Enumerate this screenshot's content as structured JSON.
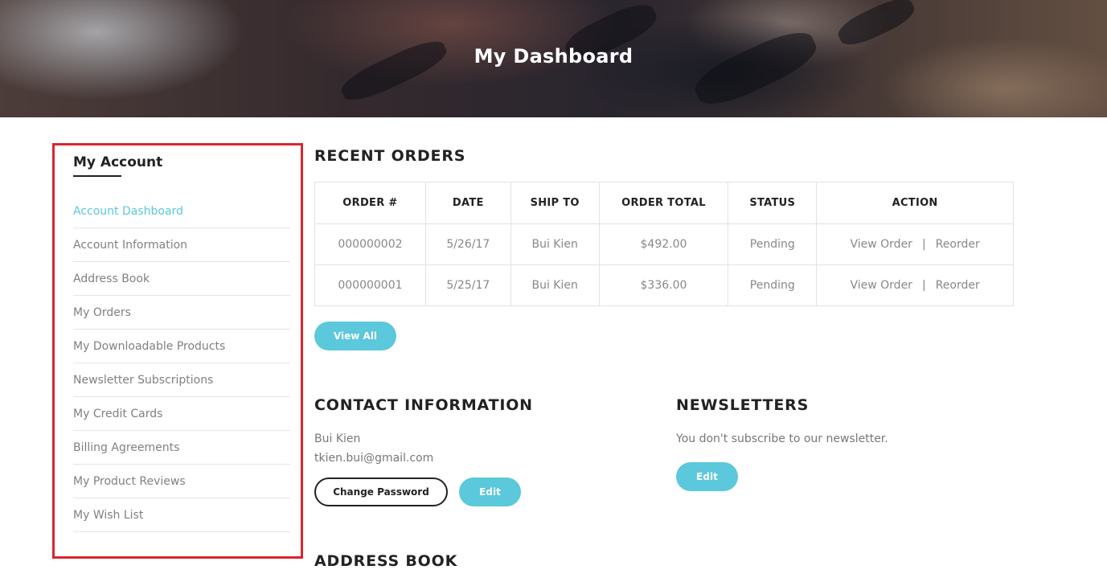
{
  "hero": {
    "title": "My Dashboard"
  },
  "sidebar": {
    "title": "My Account",
    "items": [
      {
        "label": "Account Dashboard"
      },
      {
        "label": "Account Information"
      },
      {
        "label": "Address Book"
      },
      {
        "label": "My Orders"
      },
      {
        "label": "My Downloadable Products"
      },
      {
        "label": "Newsletter Subscriptions"
      },
      {
        "label": "My Credit Cards"
      },
      {
        "label": "Billing Agreements"
      },
      {
        "label": "My Product Reviews"
      },
      {
        "label": "My Wish List"
      }
    ],
    "active_item": "Account Dashboard"
  },
  "recent_orders": {
    "title": "RECENT ORDERS",
    "columns": [
      "ORDER #",
      "DATE",
      "SHIP TO",
      "ORDER TOTAL",
      "STATUS",
      "ACTION"
    ],
    "rows": [
      {
        "order": "000000002",
        "date": "5/26/17",
        "ship_to": "Bui Kien",
        "total": "$492.00",
        "status": "Pending",
        "view": "View Order",
        "separator": "|",
        "reorder": "Reorder"
      },
      {
        "order": "000000001",
        "date": "5/25/17",
        "ship_to": "Bui Kien",
        "total": "$336.00",
        "status": "Pending",
        "view": "View Order",
        "separator": "|",
        "reorder": "Reorder"
      }
    ],
    "view_all_label": "View All"
  },
  "contact": {
    "title": "CONTACT INFORMATION",
    "name": "Bui Kien",
    "email": "tkien.bui@gmail.com",
    "change_password_label": "Change Password",
    "edit_label": "Edit"
  },
  "newsletters": {
    "title": "NEWSLETTERS",
    "message": "You don't subscribe to our newsletter.",
    "edit_label": "Edit"
  },
  "address_book": {
    "title": "ADDRESS BOOK"
  },
  "colors": {
    "accent": "#5bc8db",
    "highlight_border": "#d9262e"
  }
}
